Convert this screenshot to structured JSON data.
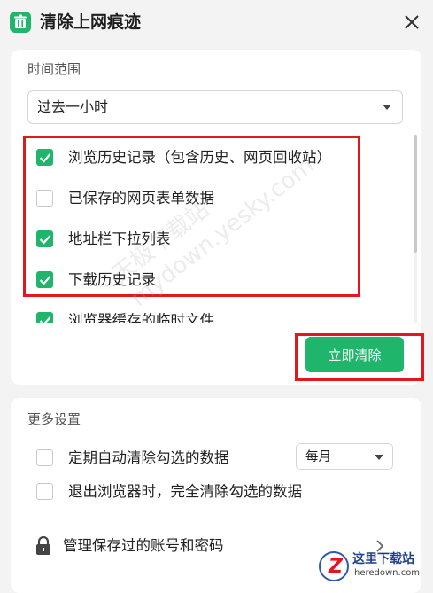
{
  "window": {
    "title": "清除上网痕迹",
    "icon": "trash-icon",
    "accent_color": "#1fb66b",
    "highlight_color": "#e3161e"
  },
  "clear_panel": {
    "time_range_label": "时间范围",
    "time_range_value": "过去一小时",
    "options": [
      {
        "label": "浏览历史记录（包含历史、网页回收站）",
        "checked": true
      },
      {
        "label": "已保存的网页表单数据",
        "checked": false
      },
      {
        "label": "地址栏下拉列表",
        "checked": true
      },
      {
        "label": "下载历史记录",
        "checked": true
      },
      {
        "label": "浏览器缓存的临时文件",
        "checked": true
      }
    ],
    "clear_button": "立即清除"
  },
  "more_settings": {
    "label": "更多设置",
    "auto_clear_label": "定期自动清除勾选的数据",
    "auto_clear_checked": false,
    "frequency_value": "每月",
    "exit_clear_label": "退出浏览器时，完全清除勾选的数据",
    "exit_clear_checked": false,
    "manage_passwords_label": "管理保存过的账号和密码"
  },
  "watermark": {
    "line1": "天极下载站",
    "line2": "mydown.yesky.com"
  },
  "corner_logo": {
    "mark": "Z",
    "cn_text": "这里下载站",
    "en_text": "heredown.com"
  }
}
